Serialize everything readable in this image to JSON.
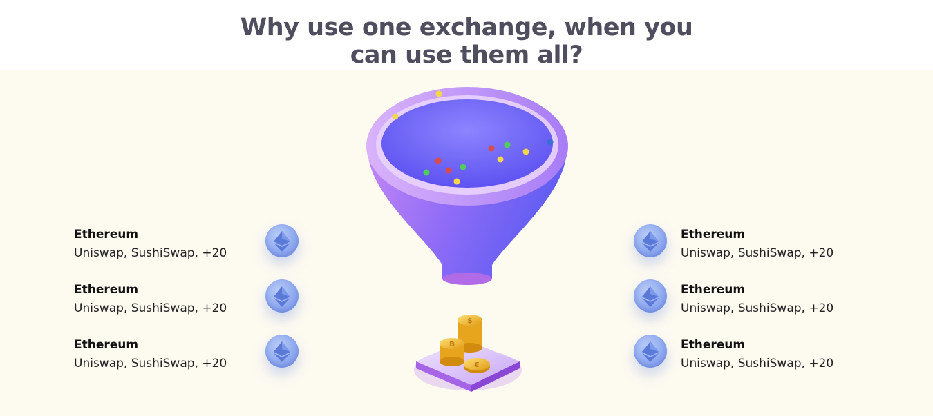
{
  "heading": {
    "line1": "Why use one exchange, when you",
    "line2": "can use them all?"
  },
  "left_list": [
    {
      "chain": "Ethereum",
      "dexes": "Uniswap, SushiSwap, +20",
      "icon": "ethereum-icon"
    },
    {
      "chain": "Ethereum",
      "dexes": "Uniswap, SushiSwap, +20",
      "icon": "ethereum-icon"
    },
    {
      "chain": "Ethereum",
      "dexes": "Uniswap, SushiSwap, +20",
      "icon": "ethereum-icon"
    }
  ],
  "right_list": [
    {
      "chain": "Ethereum",
      "dexes": "Uniswap, SushiSwap, +20",
      "icon": "ethereum-icon"
    },
    {
      "chain": "Ethereum",
      "dexes": "Uniswap, SushiSwap, +20",
      "icon": "ethereum-icon"
    },
    {
      "chain": "Ethereum",
      "dexes": "Uniswap, SushiSwap, +20",
      "icon": "ethereum-icon"
    }
  ],
  "illustration": {
    "funnel": "funnel-illustration",
    "coins": "coin-stack-illustration"
  },
  "colors": {
    "heading": "#4e4e5e",
    "panel_background": "#fdfaf0",
    "funnel_purple": "#7b5cf5",
    "eth_blue": "#8fa9ef"
  }
}
